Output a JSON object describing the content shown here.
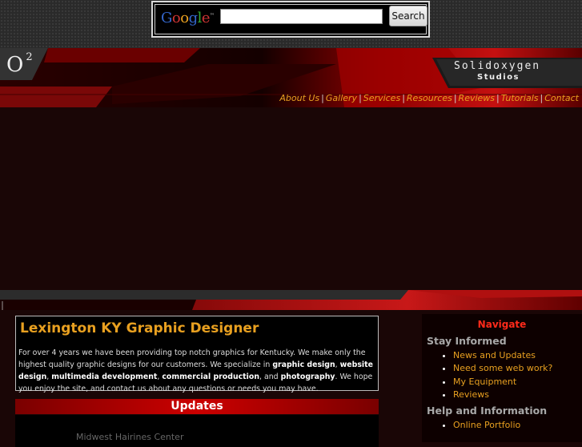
{
  "search": {
    "logo_text": "Google",
    "logo_tm": "™",
    "input_value": "",
    "button_label": "Search"
  },
  "brand": {
    "mark": "O",
    "mark_sup": "2",
    "studio_name": "Solidoxygen",
    "studio_sub": "Studios"
  },
  "nav": {
    "items": [
      "About Us",
      "Gallery",
      "Services",
      "Resources",
      "Reviews",
      "Tutorials",
      "Contact"
    ],
    "separator": "|"
  },
  "intro": {
    "title": "Lexington KY Graphic Designer",
    "text_1": "For over 4 years we have been providing top notch graphics for Kentucky. We make only the highest quality graphic designs for our customers. We specialize in ",
    "bold_1": "graphic design",
    "text_2": ", ",
    "bold_2": "website design",
    "text_3": ", ",
    "bold_3": "multimedia development",
    "text_4": ", ",
    "bold_4": "commercial production",
    "text_5": ", and ",
    "bold_5": "photography",
    "text_6": ". We hope you enjoy the site, and contact us about any questions or needs you may have."
  },
  "updates": {
    "heading": "Updates",
    "first_title": "Midwest Hairines Center"
  },
  "sidebar": {
    "heading": "Navigate",
    "sections": [
      {
        "title": "Stay Informed",
        "items": [
          "News and Updates",
          "Need some web work?",
          "My Equipment",
          "Reviews"
        ]
      },
      {
        "title": "Help and Information",
        "items": [
          "Online Portfolio"
        ]
      }
    ]
  },
  "colors": {
    "accent_orange": "#e8a020",
    "nav_red": "#ff2a1a",
    "bg": "#1a0606",
    "updates_red": "#cc0000"
  }
}
